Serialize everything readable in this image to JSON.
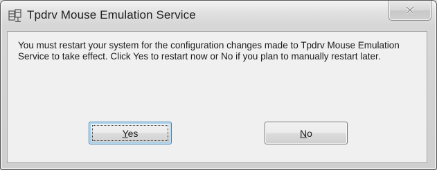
{
  "window": {
    "title": "Tpdrv Mouse Emulation Service",
    "title_icon": "service-gear-icon",
    "close_icon": "close-x-icon"
  },
  "message": {
    "text": "You must restart your system for the configuration changes made to Tpdrv Mouse Emulation Service to take effect. Click Yes to restart now or No if you plan to manually restart later."
  },
  "buttons": {
    "yes": {
      "mnemonic": "Y",
      "rest": "es"
    },
    "no": {
      "mnemonic": "N",
      "rest": "o"
    }
  },
  "colors": {
    "default_button_border": "#3c7fb1",
    "dialog_background": "#f0f0f0"
  }
}
